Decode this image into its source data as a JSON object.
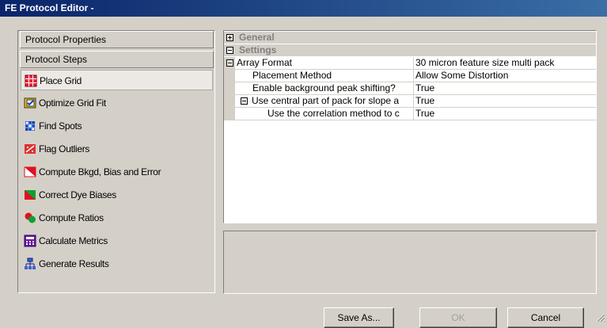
{
  "window": {
    "title": "FE Protocol Editor -"
  },
  "left_panel": {
    "sections": [
      "Protocol Properties",
      "Protocol Steps"
    ],
    "steps": [
      {
        "label": "Place Grid",
        "icon": "place-grid-icon",
        "selected": true
      },
      {
        "label": "Optimize Grid Fit",
        "icon": "optimize-grid-fit-icon"
      },
      {
        "label": "Find Spots",
        "icon": "find-spots-icon"
      },
      {
        "label": "Flag Outliers",
        "icon": "flag-outliers-icon"
      },
      {
        "label": "Compute Bkgd, Bias and Error",
        "icon": "compute-bkgd-icon"
      },
      {
        "label": "Correct Dye Biases",
        "icon": "correct-dye-biases-icon"
      },
      {
        "label": "Compute Ratios",
        "icon": "compute-ratios-icon"
      },
      {
        "label": "Calculate Metrics",
        "icon": "calculate-metrics-icon"
      },
      {
        "label": "Generate Results",
        "icon": "generate-results-icon"
      }
    ]
  },
  "property_grid": {
    "categories": [
      {
        "label": "General",
        "expanded": false
      },
      {
        "label": "Settings",
        "expanded": true
      }
    ],
    "rows": [
      {
        "name": "Array Format",
        "value": "30 micron feature size multi pack"
      },
      {
        "name": "Placement Method",
        "value": "Allow Some Distortion"
      },
      {
        "name": "Enable background peak shifting?",
        "value": "True"
      },
      {
        "name": "Use central part of pack for slope a",
        "value": "True"
      },
      {
        "name": "Use the correlation method to c",
        "value": "True"
      }
    ]
  },
  "buttons": {
    "save_as": "Save As...",
    "ok": "OK",
    "cancel": "Cancel"
  },
  "colors": {
    "title_bar": "#0a246a",
    "face": "#d4d0c8",
    "selected_step": "#ece9e4"
  }
}
